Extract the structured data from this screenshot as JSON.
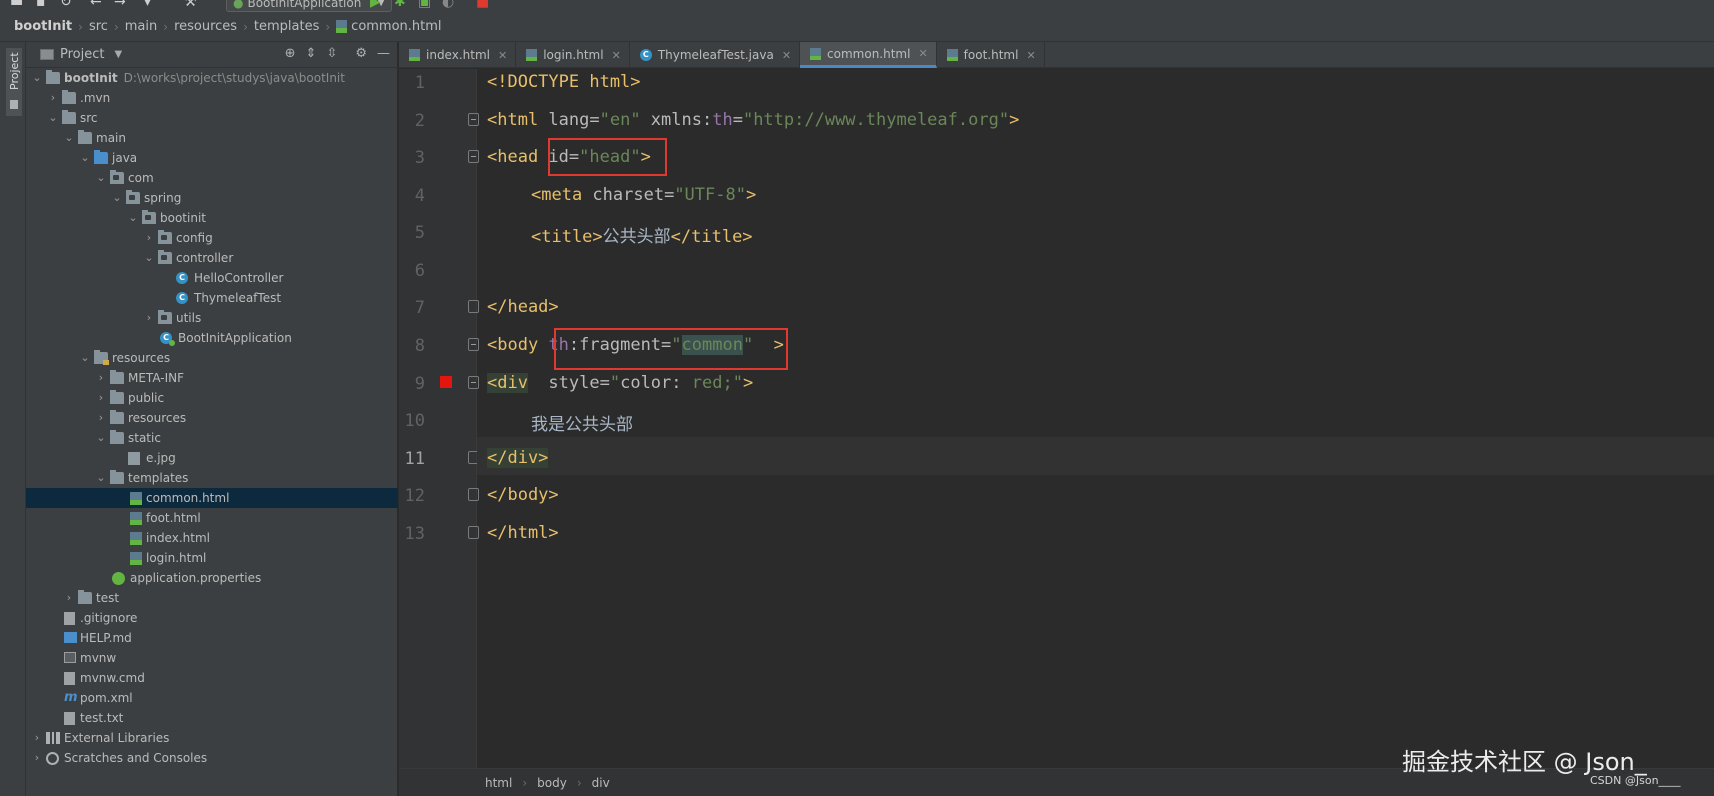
{
  "toolbar": {
    "run_config_label": "BootInitApplication"
  },
  "navbar": {
    "crumbs": [
      "bootInit",
      "src",
      "main",
      "resources",
      "templates",
      "common.html"
    ]
  },
  "tool_strip": {
    "project_label": "Project"
  },
  "project_panel": {
    "title": "Project",
    "tree": [
      {
        "label": "bootInit",
        "path": "D:\\works\\project\\studys\\java\\bootInit"
      },
      {
        "label": ".mvn"
      },
      {
        "label": "src"
      },
      {
        "label": "main"
      },
      {
        "label": "java"
      },
      {
        "label": "com"
      },
      {
        "label": "spring"
      },
      {
        "label": "bootinit"
      },
      {
        "label": "config"
      },
      {
        "label": "controller"
      },
      {
        "label": "HelloController"
      },
      {
        "label": "ThymeleafTest"
      },
      {
        "label": "utils"
      },
      {
        "label": "BootInitApplication"
      },
      {
        "label": "resources"
      },
      {
        "label": "META-INF"
      },
      {
        "label": "public"
      },
      {
        "label": "resources"
      },
      {
        "label": "static"
      },
      {
        "label": "e.jpg"
      },
      {
        "label": "templates"
      },
      {
        "label": "common.html"
      },
      {
        "label": "foot.html"
      },
      {
        "label": "index.html"
      },
      {
        "label": "login.html"
      },
      {
        "label": "application.properties"
      },
      {
        "label": "test"
      },
      {
        "label": ".gitignore"
      },
      {
        "label": "HELP.md"
      },
      {
        "label": "mvnw"
      },
      {
        "label": "mvnw.cmd"
      },
      {
        "label": "pom.xml"
      },
      {
        "label": "test.txt"
      },
      {
        "label": "External Libraries"
      },
      {
        "label": "Scratches and Consoles"
      }
    ]
  },
  "tabs": [
    {
      "label": "index.html"
    },
    {
      "label": "login.html"
    },
    {
      "label": "ThymeleafTest.java"
    },
    {
      "label": "common.html"
    },
    {
      "label": "foot.html"
    }
  ],
  "editor": {
    "line_numbers": [
      "1",
      "2",
      "3",
      "4",
      "5",
      "6",
      "7",
      "8",
      "9",
      "10",
      "11",
      "12",
      "13"
    ],
    "code": {
      "l1": {
        "t": "<!DOCTYPE html>"
      },
      "l2": {
        "a": "<html",
        "b": " lang=",
        "c": "\"en\"",
        "d": " xmlns:",
        "e": "th",
        "f": "=",
        "g": "\"http://www.thymeleaf.org\"",
        "h": ">"
      },
      "l3": {
        "a": "<head",
        "b": " id=",
        "c": "\"head\"",
        "d": ">"
      },
      "l4": {
        "a": "<meta",
        "b": " charset=",
        "c": "\"UTF-8\"",
        "d": ">"
      },
      "l5": {
        "a": "<title>",
        "b": "公共头部",
        "c": "</title>"
      },
      "l7": {
        "a": "</head>"
      },
      "l8": {
        "a": "<body",
        "b": " ",
        "c": "th",
        "d": ":fragment=",
        "e": "\"",
        "f": "common",
        "g": "\"",
        "h": "  >"
      },
      "l9": {
        "a": "<div",
        "b": "  style=",
        "c": "\"",
        "d": "color: ",
        "e": "red;",
        "f": "\"",
        "g": ">"
      },
      "l10": {
        "t": "我是公共头部"
      },
      "l11": {
        "a": "</div>"
      },
      "l12": {
        "a": "</body>"
      },
      "l13": {
        "a": "</html>"
      }
    }
  },
  "structure_bar": {
    "items": [
      "html",
      "body",
      "div"
    ]
  },
  "watermark": {
    "main": "掘金技术社区 @ Json_",
    "sub": "CSDN @Json____"
  },
  "colors": {
    "selection": "#0d293e",
    "tag": "#e8bf6a",
    "value": "#6a8759",
    "namespace": "#9876aa",
    "highlight_box": "#e0392f",
    "active_tab_underline": "#4a88c7"
  }
}
